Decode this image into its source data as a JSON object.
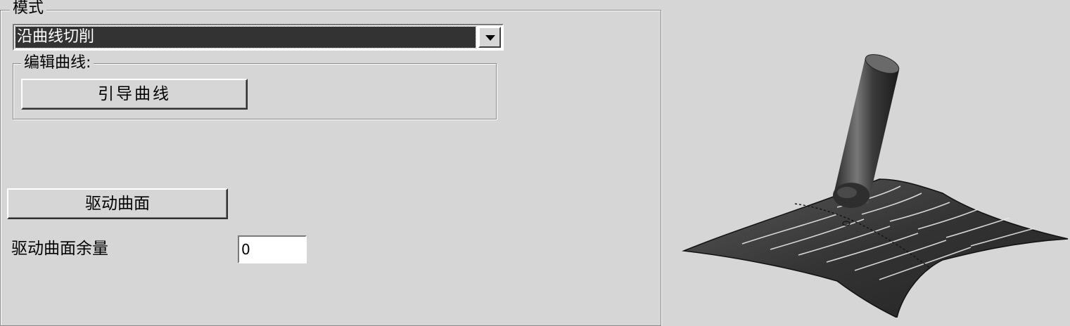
{
  "mode_group": {
    "legend": "模式"
  },
  "mode_select": {
    "value": "沿曲线切削"
  },
  "edit_curve_group": {
    "legend": "编辑曲线:"
  },
  "buttons": {
    "guide_curve": "引导曲线",
    "drive_surface": "驱动曲面"
  },
  "drive_surface_allowance": {
    "label": "驱动曲面余量",
    "value": "0"
  },
  "illustration": {
    "icon": "ball-end-mill-on-surface-icon",
    "surface_color": "#3a3a3a",
    "tool_color": "#4a4a4a"
  }
}
